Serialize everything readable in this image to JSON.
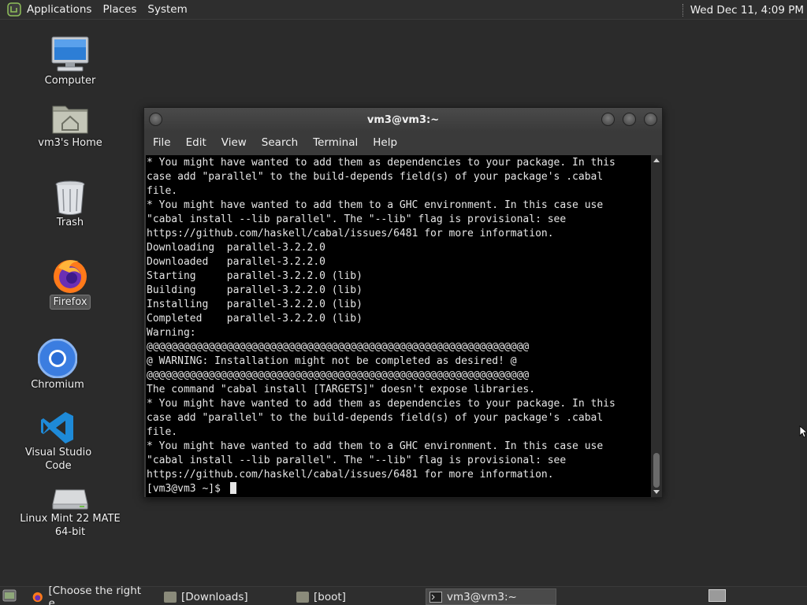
{
  "top_panel": {
    "menus": [
      "Applications",
      "Places",
      "System"
    ],
    "clock": "Wed Dec 11,  4:09 PM"
  },
  "desktop_icons": [
    {
      "label": "Computer",
      "icon": "computer-icon"
    },
    {
      "label": "vm3's Home",
      "icon": "home-folder-icon"
    },
    {
      "label": "Trash",
      "icon": "trash-icon"
    },
    {
      "label": "Firefox",
      "icon": "firefox-icon"
    },
    {
      "label": "Chromium",
      "icon": "chromium-icon"
    },
    {
      "label": "Visual Studio Code",
      "icon": "vscode-icon"
    },
    {
      "label": "Linux Mint 22 MATE",
      "label2": "64-bit",
      "icon": "drive-icon"
    }
  ],
  "terminal": {
    "title": "vm3@vm3:~",
    "menus": [
      "File",
      "Edit",
      "View",
      "Search",
      "Terminal",
      "Help"
    ],
    "lines": [
      "* You might have wanted to add them as dependencies to your package. In this",
      "case add \"parallel\" to the build-depends field(s) of your package's .cabal",
      "file.",
      "* You might have wanted to add them to a GHC environment. In this case use",
      "\"cabal install --lib parallel\". The \"--lib\" flag is provisional: see",
      "https://github.com/haskell/cabal/issues/6481 for more information.",
      "Downloading  parallel-3.2.2.0",
      "Downloaded   parallel-3.2.2.0",
      "Starting     parallel-3.2.2.0 (lib)",
      "Building     parallel-3.2.2.0 (lib)",
      "Installing   parallel-3.2.2.0 (lib)",
      "Completed    parallel-3.2.2.0 (lib)",
      "Warning:",
      "@@@@@@@@@@@@@@@@@@@@@@@@@@@@@@@@@@@@@@@@@@@@@@@@@@@@@@@@@@@@@@",
      "@ WARNING: Installation might not be completed as desired! @",
      "@@@@@@@@@@@@@@@@@@@@@@@@@@@@@@@@@@@@@@@@@@@@@@@@@@@@@@@@@@@@@@",
      "The command \"cabal install [TARGETS]\" doesn't expose libraries.",
      "* You might have wanted to add them as dependencies to your package. In this",
      "case add \"parallel\" to the build-depends field(s) of your package's .cabal",
      "file.",
      "* You might have wanted to add them to a GHC environment. In this case use",
      "\"cabal install --lib parallel\". The \"--lib\" flag is provisional: see",
      "https://github.com/haskell/cabal/issues/6481 for more information."
    ],
    "prompt": "[vm3@vm3 ~]$ "
  },
  "taskbar": {
    "items": [
      {
        "label": "[Choose the right e...",
        "icon": "firefox-icon",
        "active": false
      },
      {
        "label": "[Downloads]",
        "icon": "folder-icon",
        "active": false
      },
      {
        "label": "[boot]",
        "icon": "folder-icon",
        "active": false
      },
      {
        "label": "vm3@vm3:~",
        "icon": "terminal-icon",
        "active": true
      }
    ]
  }
}
